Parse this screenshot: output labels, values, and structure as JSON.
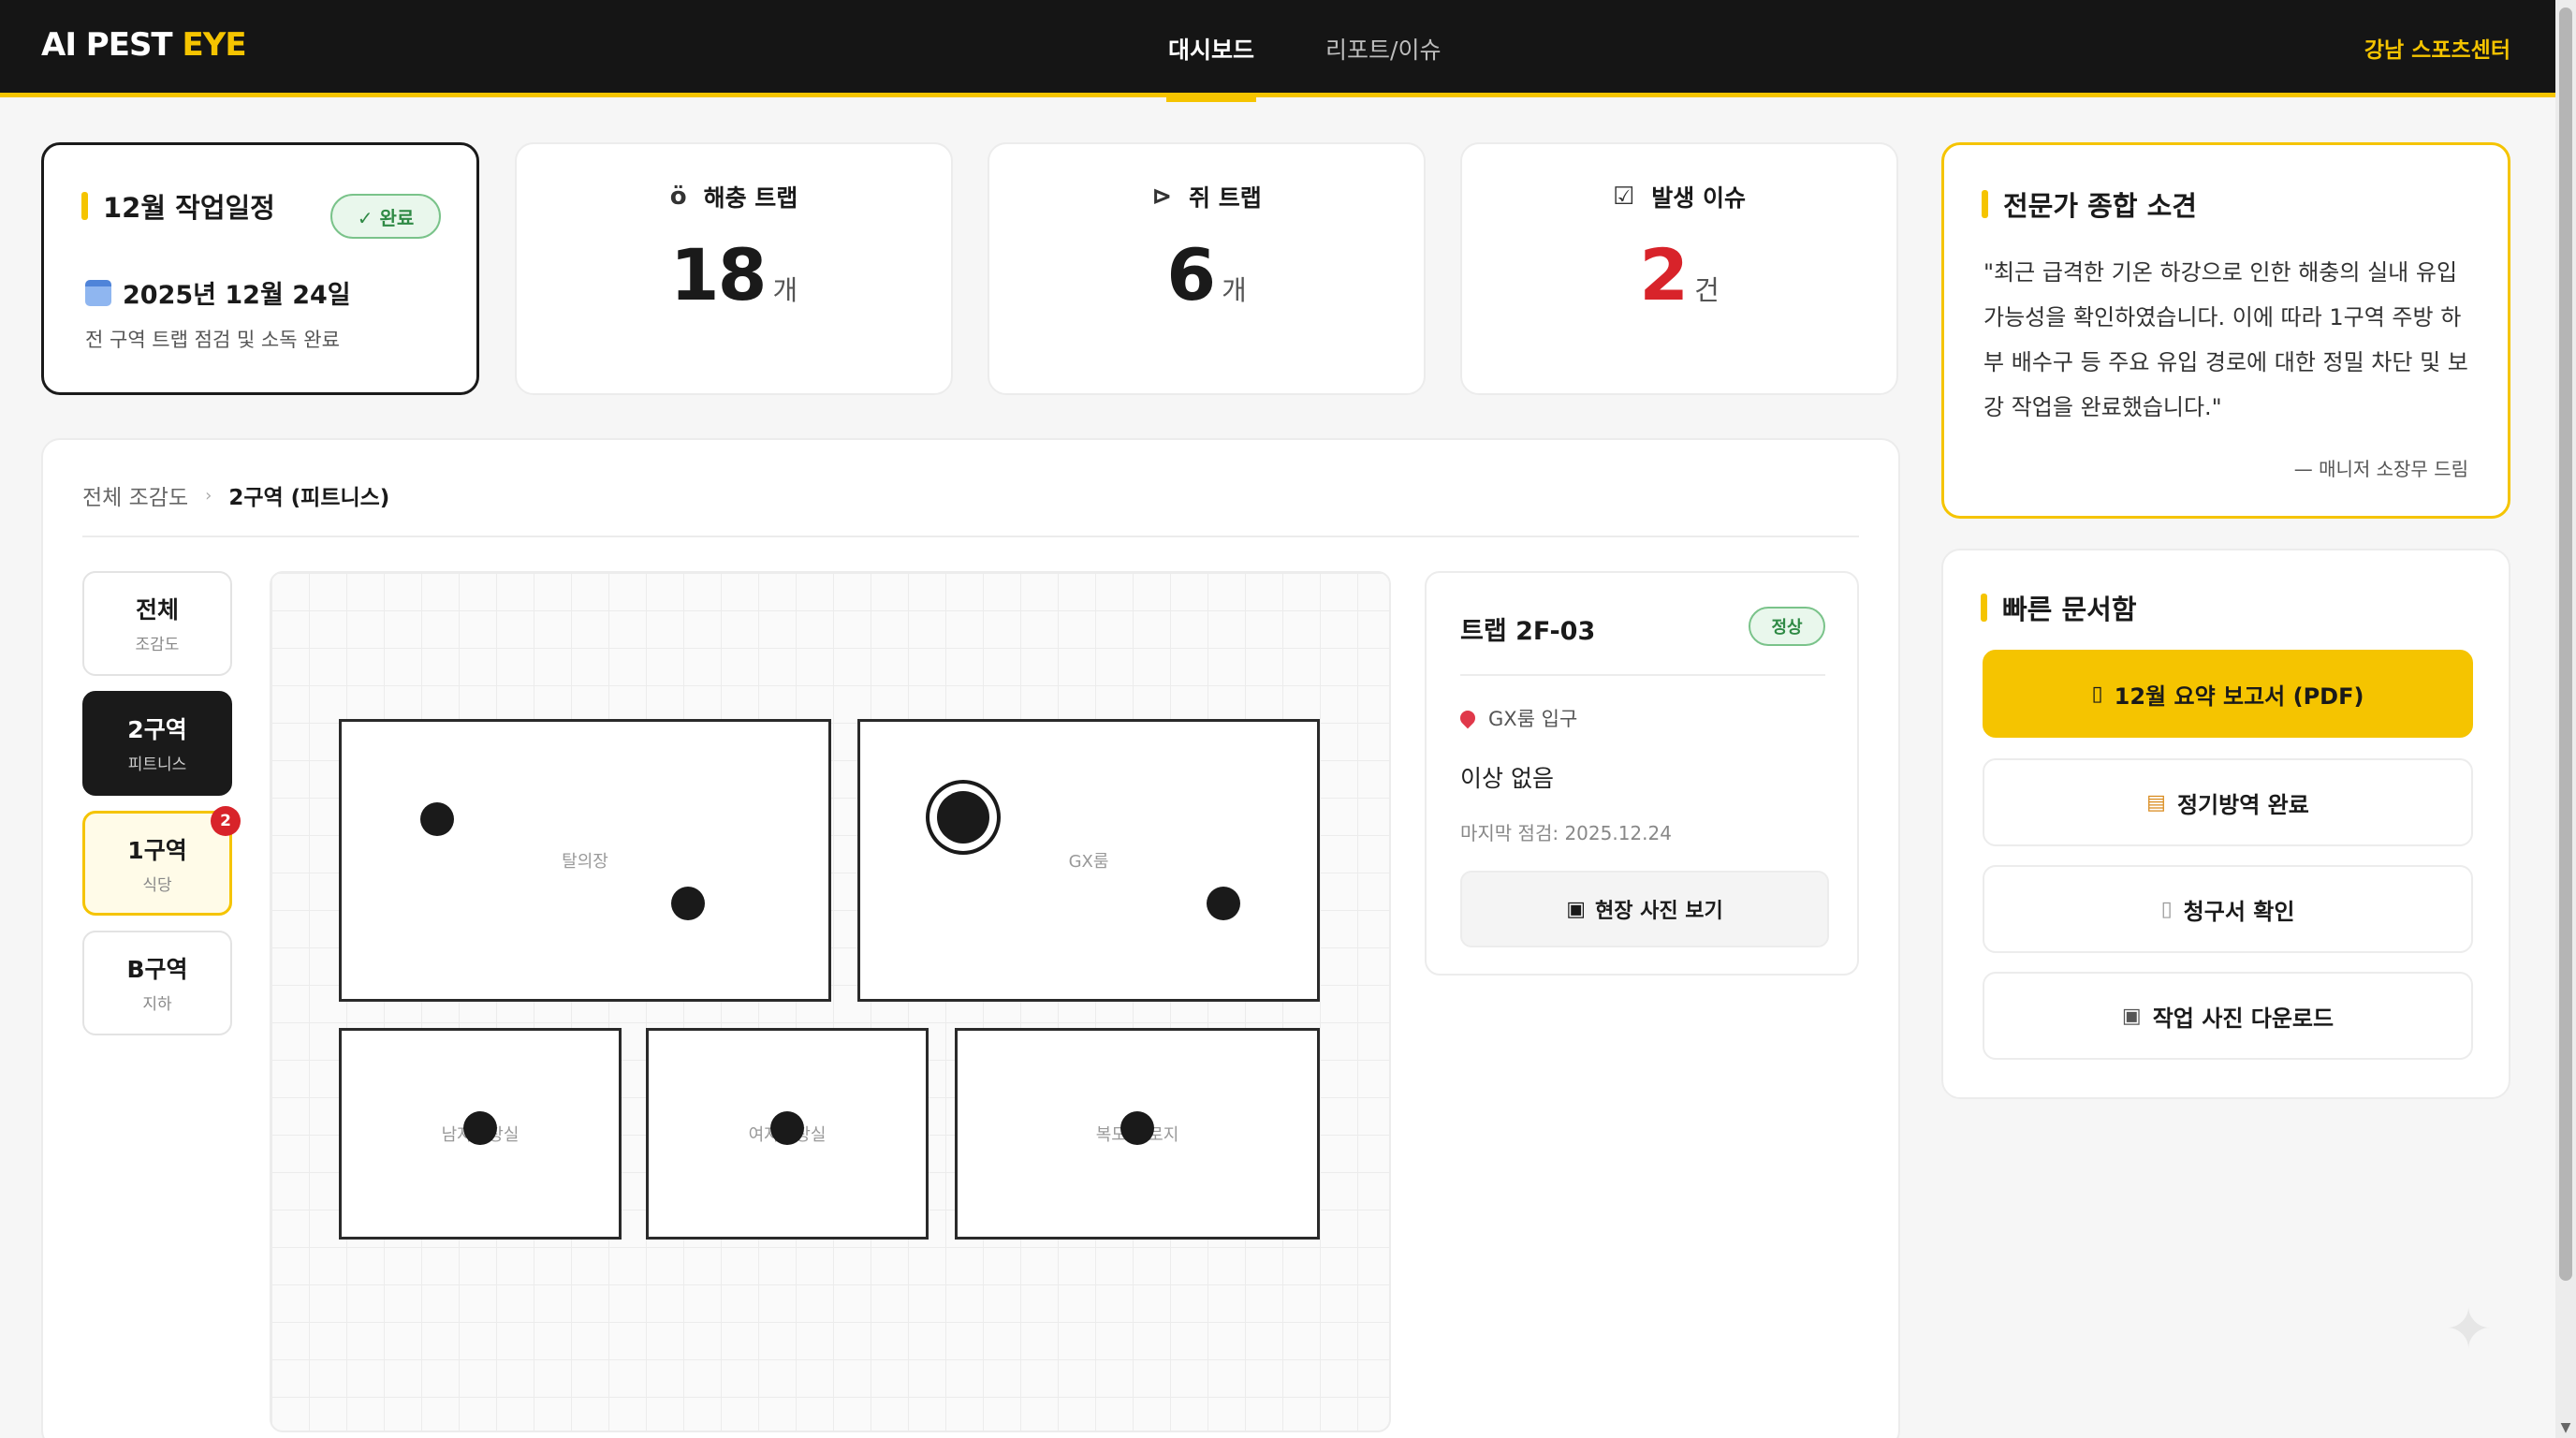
{
  "header": {
    "logo_main": "AI PEST",
    "logo_accent": "EYE",
    "nav": [
      {
        "label": "대시보드"
      },
      {
        "label": "리포트/이슈"
      }
    ],
    "site": "강남 스포츠센터"
  },
  "schedule": {
    "title": "12월 작업일정",
    "badge": "✓ 완료",
    "date": "2025년 12월 24일",
    "note": "전 구역 트랩 점검 및 소독 완료"
  },
  "stats": [
    {
      "label": "해충 트랩",
      "value": "18",
      "unit": "개",
      "icon": "bug-icon"
    },
    {
      "label": "쥐 트랩",
      "value": "6",
      "unit": "개",
      "icon": "mouse-icon"
    },
    {
      "label": "발생 이슈",
      "value": "2",
      "unit": "건",
      "icon": "checkbox-icon"
    }
  ],
  "expert": {
    "title": "전문가 종합 소견",
    "text": "\"최근 급격한 기온 하강으로 인한 해충의 실내 유입 가능성을 확인하였습니다. 이에 따라 1구역 주방 하부 배수구 등 주요 유입 경로에 대한 정밀 차단 및 보강 작업을 완료했습니다.\"",
    "sign": "— 매니저 소장무 드림"
  },
  "docs": {
    "title": "빠른 문서함",
    "buttons": [
      {
        "label": "12월 요약 보고서 (PDF)",
        "icon": "document-icon"
      },
      {
        "label": "정기방역 완료",
        "icon": "scroll-icon"
      },
      {
        "label": "청구서 확인",
        "icon": "invoice-icon"
      },
      {
        "label": "작업 사진 다운로드",
        "icon": "camera-icon"
      }
    ]
  },
  "map": {
    "breadcrumb_root": "전체 조감도",
    "breadcrumb_sep": "›",
    "breadcrumb_current": "2구역 (피트니스)",
    "zones": [
      {
        "name": "전체",
        "sub": "조감도"
      },
      {
        "name": "2구역",
        "sub": "피트니스"
      },
      {
        "name": "1구역",
        "sub": "식당",
        "badge": "2"
      },
      {
        "name": "B구역",
        "sub": "지하"
      }
    ],
    "rooms": [
      {
        "label": "탈의장"
      },
      {
        "label": "GX룸"
      },
      {
        "label": "남자화장실"
      },
      {
        "label": "여자화장실"
      },
      {
        "label": "복도 통로지"
      }
    ]
  },
  "detail": {
    "title": "트랩 2F-03",
    "badge": "정상",
    "location": "GX룸 입구",
    "status": "이상 없음",
    "inspected": "마지막 점검: 2025.12.24",
    "photo_button": "현장 사진 보기"
  },
  "colors": {
    "accent": "#f5c400",
    "dark": "#151515",
    "alert": "#d8232a",
    "ok": "#2f8a45"
  }
}
